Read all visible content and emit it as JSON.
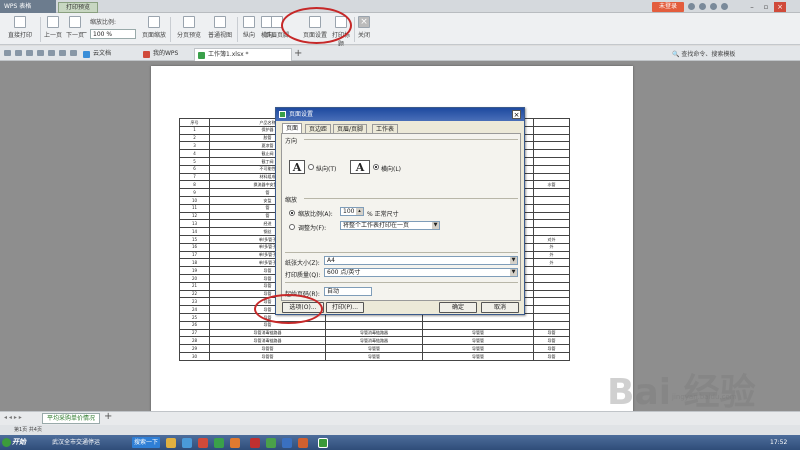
{
  "app": {
    "name": "WPS 表格",
    "preview_tab": "打印预览",
    "login": "未登录"
  },
  "ribbon": {
    "direct_print": "直接打印",
    "prev_page": "上一页",
    "next_page": "下一页",
    "zoom_label": "缩放比例:",
    "zoom_value": "100 %",
    "page_zoom": "页面缩放",
    "page_break_preview": "分页预览",
    "normal_view": "普通视图",
    "portrait": "纵向",
    "landscape": "横向",
    "header_footer": "页眉页脚",
    "margins": "页边距",
    "page_setup": "页面设置",
    "print_title": "打印标题",
    "close": "关闭"
  },
  "tabs": [
    {
      "label": "云文档",
      "color": "#3a8ed8"
    },
    {
      "label": "我的WPS",
      "color": "#d04a3a"
    },
    {
      "label": "工作簿1.xlsx *",
      "color": "#3aa04a"
    }
  ],
  "right_tools": "查找命令、搜索模板",
  "table": {
    "header": [
      "序号",
      "产品名称",
      "",
      "",
      ""
    ],
    "rows": [
      [
        "1",
        "保护器",
        "",
        "",
        ""
      ],
      [
        "2",
        "胶管",
        "",
        "",
        ""
      ],
      [
        "3",
        "夏凉管",
        "",
        "",
        ""
      ],
      [
        "4",
        "截止阀",
        "",
        "",
        ""
      ],
      [
        "5",
        "截丁阀",
        "",
        "",
        ""
      ],
      [
        "6",
        "不可能性",
        "",
        "",
        ""
      ],
      [
        "7",
        "材料组成",
        "",
        "",
        ""
      ],
      [
        "8",
        "换流器中安置阀",
        "",
        "",
        "水管"
      ],
      [
        "9",
        "管",
        "",
        "",
        ""
      ],
      [
        "10",
        "安监",
        "",
        "",
        ""
      ],
      [
        "11",
        "管",
        "",
        "",
        ""
      ],
      [
        "12",
        "管",
        "",
        "",
        ""
      ],
      [
        "13",
        "经进",
        "",
        "",
        ""
      ],
      [
        "14",
        "钢丝",
        "",
        "",
        ""
      ],
      [
        "15",
        "单/多管子",
        "",
        "",
        "对外"
      ],
      [
        "16",
        "单/多管子",
        "",
        "",
        "外"
      ],
      [
        "17",
        "单/多管子",
        "",
        "",
        "外"
      ],
      [
        "18",
        "单/多管子",
        "",
        "",
        "外"
      ],
      [
        "19",
        "导管",
        "",
        "",
        ""
      ],
      [
        "20",
        "导管",
        "",
        "",
        ""
      ],
      [
        "21",
        "导管",
        "",
        "",
        ""
      ],
      [
        "22",
        "导管",
        "",
        "",
        ""
      ],
      [
        "23",
        "导管",
        "",
        "",
        ""
      ],
      [
        "24",
        "导管",
        "",
        "",
        ""
      ],
      [
        "25",
        "导管",
        "",
        "",
        ""
      ],
      [
        "26",
        "导管",
        "",
        "",
        ""
      ],
      [
        "27",
        "导管消毒链路器",
        "导管消毒链路器",
        "导管管",
        "导管"
      ],
      [
        "28",
        "导管消毒链路器",
        "导管消毒链路器",
        "导管管",
        "导管"
      ],
      [
        "29",
        "导管管",
        "导管管",
        "导管管",
        "导管"
      ],
      [
        "30",
        "导管管",
        "导管管",
        "导管管",
        "导管"
      ]
    ]
  },
  "dialog": {
    "title": "页面设置",
    "tabs": [
      "页面",
      "页边距",
      "页眉/页脚",
      "工作表"
    ],
    "orientation_heading": "方向",
    "portrait": "纵向(T)",
    "landscape": "横向(L)",
    "scaling_heading": "缩放",
    "scale_to": "缩放比例(A):",
    "scale_value": "100",
    "scale_unit": "% 正常尺寸",
    "fit_to": "调整为(F):",
    "fit_value": "将整个工作表打印在一页",
    "paper_size_label": "纸张大小(Z):",
    "paper_size": "A4",
    "print_quality_label": "打印质量(Q):",
    "print_quality": "600 点/英寸",
    "first_page_label": "起始页码(R):",
    "first_page": "自动",
    "options_button": "选项(O)...",
    "print_button": "打印(P)...",
    "ok_button": "确定",
    "cancel_button": "取消"
  },
  "sheet_tab": "平均采购单价情况",
  "status": "第1页 共4页",
  "taskbar": {
    "start": "开始",
    "item1": "武汉全市交通停运",
    "item2": "搜索一下",
    "clock": "17:52"
  },
  "watermark": {
    "main": "Bai 经验",
    "sub": "jingyan.baidu.com"
  }
}
